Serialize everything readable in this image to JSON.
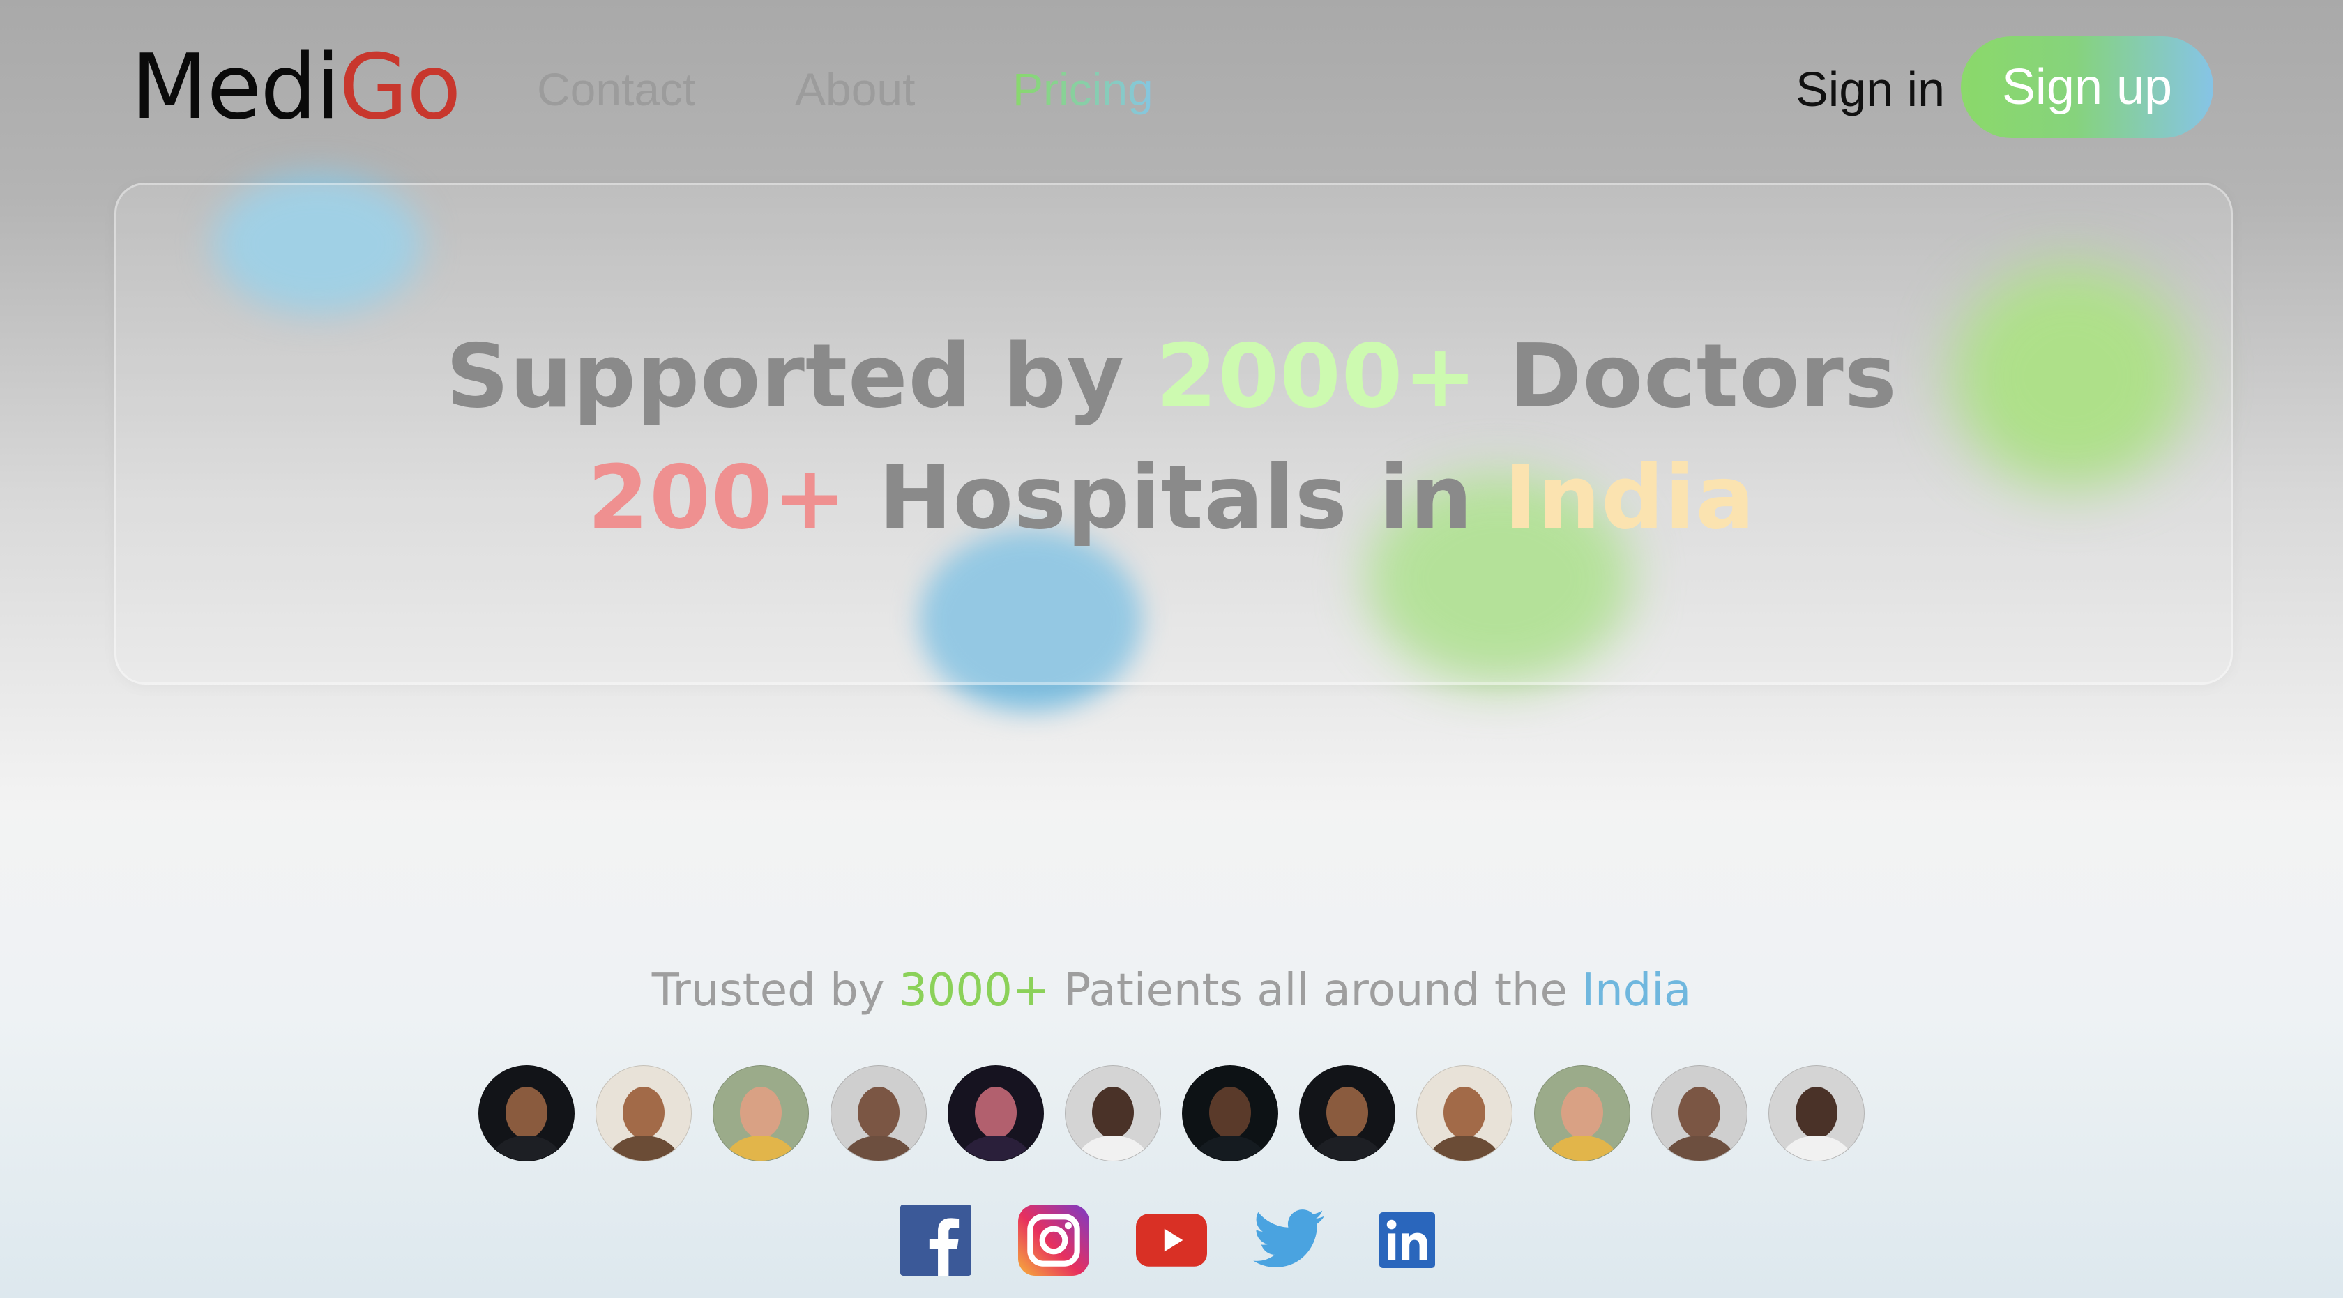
{
  "brand": {
    "part1": "Medi",
    "part2": "Go"
  },
  "nav": {
    "contact": "Contact",
    "about": "About",
    "pricing": "Pricing"
  },
  "auth": {
    "signin": "Sign in",
    "signup": "Sign up"
  },
  "hero": {
    "line1": {
      "a": "Supported by ",
      "b": "2000+",
      "c": " Doctors"
    },
    "line2": {
      "a": "200+",
      "b": " Hospitals in ",
      "c": "India"
    }
  },
  "trusted": {
    "a": "Trusted by ",
    "b": "3000+",
    "c": " Patients all around the ",
    "d": "India"
  },
  "avatars": [
    "avatar-1",
    "avatar-2",
    "avatar-3",
    "avatar-4",
    "avatar-5",
    "avatar-6",
    "avatar-7",
    "avatar-8",
    "avatar-9",
    "avatar-10",
    "avatar-11",
    "avatar-12"
  ],
  "socials": [
    "facebook-icon",
    "instagram-icon",
    "youtube-icon",
    "twitter-icon",
    "linkedin-icon"
  ],
  "colors": {
    "brand_red": "#c8372d",
    "accent_green": "#8bd96a",
    "accent_blue": "#86c6e2",
    "facebook": "#3b5998",
    "youtube": "#d93025",
    "twitter": "#4aa3e0",
    "linkedin": "#2a66bc"
  }
}
